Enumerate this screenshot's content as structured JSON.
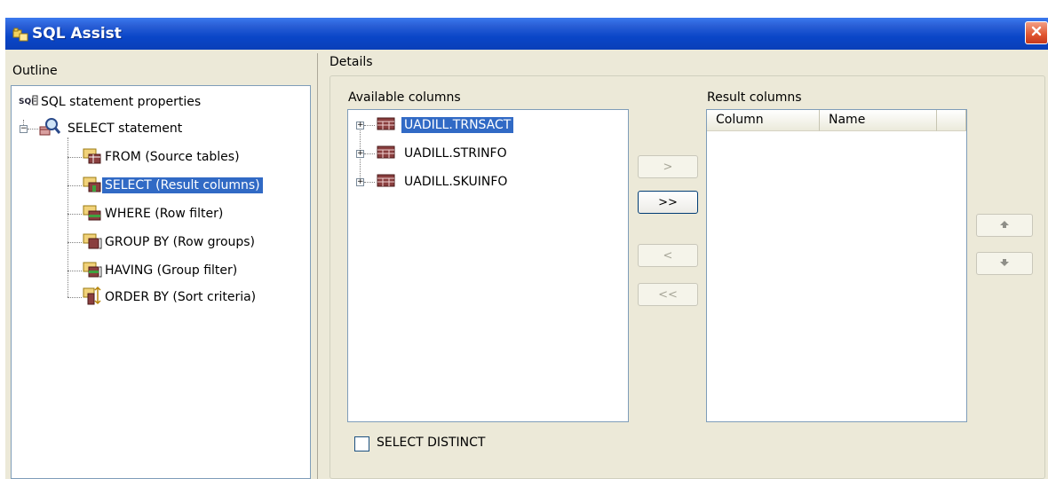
{
  "window": {
    "title": "SQL Assist"
  },
  "outline": {
    "label": "Outline",
    "items": [
      {
        "label": "SQL statement properties",
        "icon": "sql-properties-icon"
      },
      {
        "label": "SELECT statement",
        "icon": "magnifier-select-icon"
      },
      {
        "label": "FROM (Source tables)",
        "icon": "folder-table-icon"
      },
      {
        "label": "SELECT (Result columns)",
        "icon": "folder-result-columns-icon",
        "selected": true
      },
      {
        "label": "WHERE (Row filter)",
        "icon": "folder-row-filter-icon"
      },
      {
        "label": "GROUP BY (Row groups)",
        "icon": "folder-row-groups-icon"
      },
      {
        "label": "HAVING (Group filter)",
        "icon": "folder-group-filter-icon"
      },
      {
        "label": "ORDER BY (Sort criteria)",
        "icon": "folder-sort-icon"
      }
    ]
  },
  "details": {
    "label": "Details",
    "available_label": "Available columns",
    "tables": [
      {
        "name": "UADILL.TRNSACT",
        "selected": true
      },
      {
        "name": "UADILL.STRINFO",
        "selected": false
      },
      {
        "name": "UADILL.SKUINFO",
        "selected": false
      }
    ],
    "buttons": {
      "add": ">",
      "add_all": ">>",
      "remove": "<",
      "remove_all": "<<"
    },
    "result_label": "Result columns",
    "result_headers": [
      "Column",
      "Name"
    ],
    "distinct_label": "SELECT DISTINCT",
    "distinct_checked": false
  },
  "colors": {
    "title_bar": "#0a46c8",
    "selection": "#316ac5",
    "window_bg": "#ece9d8",
    "close_button": "#e0552f"
  }
}
